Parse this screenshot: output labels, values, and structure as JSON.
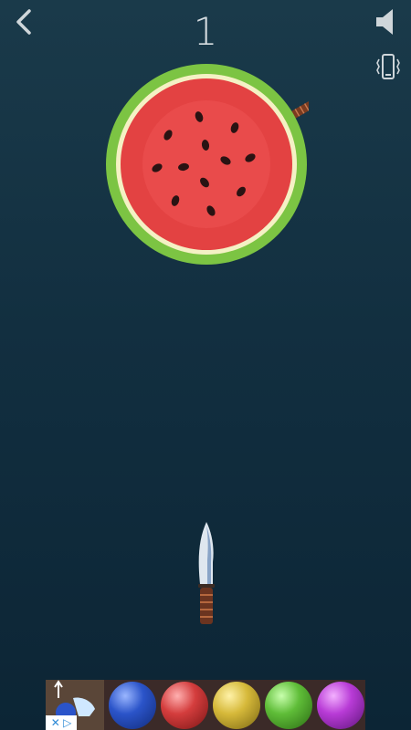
{
  "hud": {
    "score": "1",
    "back_icon": "chevron-left-icon",
    "sound_icon": "speaker-icon",
    "vibrate_icon": "vibrate-phone-icon"
  },
  "game": {
    "target": "watermelon",
    "stuck_knives": 1,
    "knife": "knife"
  },
  "ad": {
    "close_label": "✕ ▷",
    "balls": [
      "blue",
      "red",
      "yellow",
      "green",
      "purple"
    ]
  },
  "colors": {
    "background": "#163545",
    "rind": "#7cc443",
    "flesh": "#e34242",
    "hud_text": "#d7dde1"
  }
}
